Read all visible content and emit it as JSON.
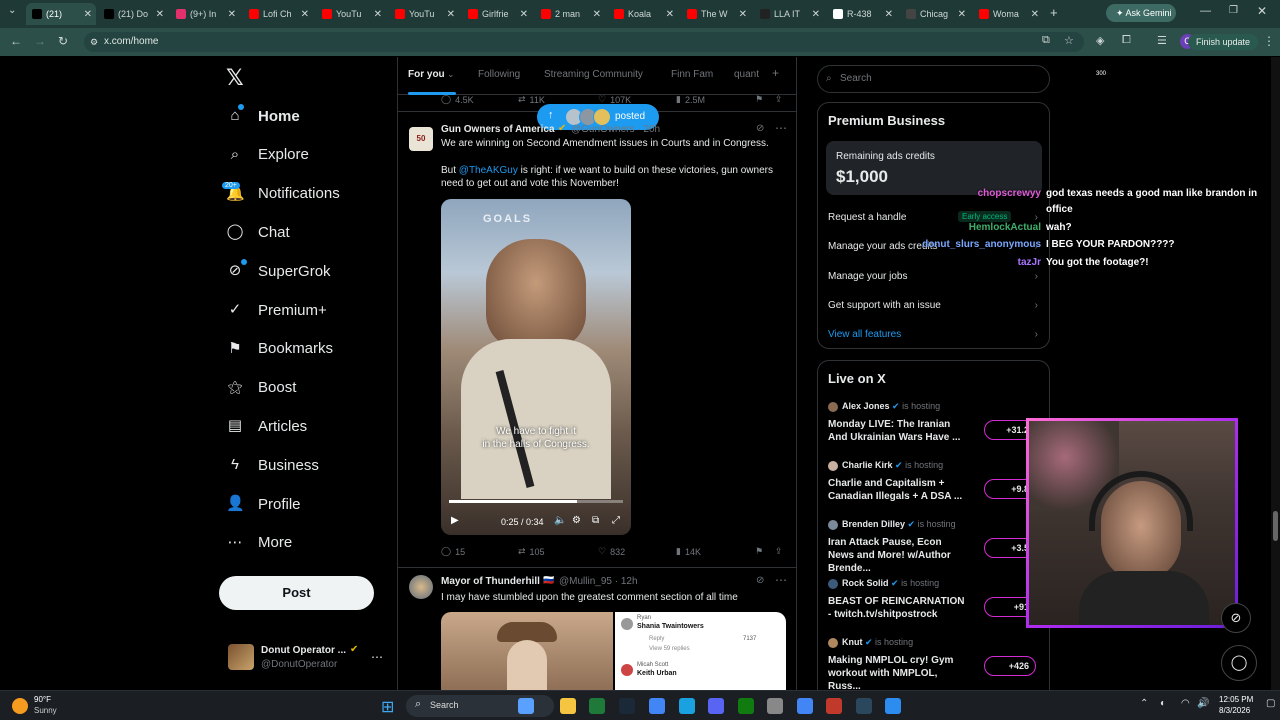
{
  "browser": {
    "tabs": [
      {
        "label": "(21)",
        "color": "#000000"
      },
      {
        "label": "(21) Do",
        "color": "#000000"
      },
      {
        "label": "(9+) In",
        "color": "#e1306c"
      },
      {
        "label": "Lofi Ch",
        "color": "#ff0000"
      },
      {
        "label": "YouTu",
        "color": "#ff0000"
      },
      {
        "label": "YouTu",
        "color": "#ff0000"
      },
      {
        "label": "Girlfrie",
        "color": "#ff0000"
      },
      {
        "label": "2 man",
        "color": "#ff0000"
      },
      {
        "label": "Koala",
        "color": "#ff0000"
      },
      {
        "label": "The W",
        "color": "#ff0000"
      },
      {
        "label": "LLA IT",
        "color": "#222222"
      },
      {
        "label": "R-438",
        "color": "#ffffff"
      },
      {
        "label": "Chicag",
        "color": "#444444"
      },
      {
        "label": "Woma",
        "color": "#ff0000"
      }
    ],
    "ask_gemini": "Ask Gemini",
    "url": "x.com/home",
    "finish_update": "Finish update",
    "ext_badge": "300"
  },
  "nav": {
    "items": [
      {
        "label": "Home",
        "icon": "home-icon",
        "glyph": "⌂"
      },
      {
        "label": "Explore",
        "icon": "search-icon",
        "glyph": "⌕"
      },
      {
        "label": "Notifications",
        "icon": "bell-icon",
        "glyph": "🔔"
      },
      {
        "label": "Chat",
        "icon": "chat-icon",
        "glyph": "◯"
      },
      {
        "label": "SuperGrok",
        "icon": "grok-icon",
        "glyph": "⊘"
      },
      {
        "label": "Premium+",
        "icon": "premium-icon",
        "glyph": "✓"
      },
      {
        "label": "Bookmarks",
        "icon": "bookmark-icon",
        "glyph": "⚑"
      },
      {
        "label": "Boost",
        "icon": "boost-icon",
        "glyph": "⚝"
      },
      {
        "label": "Articles",
        "icon": "articles-icon",
        "glyph": "▤"
      },
      {
        "label": "Business",
        "icon": "lightning-icon",
        "glyph": "ϟ"
      },
      {
        "label": "Profile",
        "icon": "profile-icon",
        "glyph": "👤"
      },
      {
        "label": "More",
        "icon": "more-icon",
        "glyph": "⋯"
      }
    ],
    "notif_badge": "20+",
    "post": "Post",
    "account_name": "Donut Operator ...",
    "account_handle": "@DonutOperator"
  },
  "feed": {
    "tabs": [
      "For you",
      "Following",
      "Streaming Community",
      "Finn Fam",
      "quant"
    ],
    "top_stats": {
      "replies": "4.5K",
      "reposts": "11K",
      "likes": "107K",
      "views": "2.5M"
    },
    "posted_pill": "posted",
    "tweet1": {
      "name": "Gun Owners of America",
      "handle": "@GunOwners · 20h",
      "line1": "We are winning on Second Amendment issues in Courts and in Congress.",
      "line2_pre": "But ",
      "line2_link": "@TheAKGuy",
      "line2_post": " is right: if we want to build on these victories, gun owners need to get out and vote this November!",
      "video_caption_1": "We have to fight it",
      "video_caption_2": "in the halls of Congress.",
      "video_banner": "GOALS",
      "video_time": "0:25 / 0:34",
      "replies": "15",
      "reposts": "105",
      "likes": "832",
      "views": "14K"
    },
    "tweet2": {
      "name": "Mayor of Thunderhill",
      "handle": "@Mullin_95 · 12h",
      "text": "I may have stumbled upon the greatest comment section of all time",
      "img_name_1": "Shania Twaintowers",
      "img_name_2": "Keith Urban",
      "img_ryan": "Ryan",
      "img_reply": "Reply",
      "img_view": "View 59 replies",
      "img_micah": "Micah Scott",
      "img_count": "7137"
    }
  },
  "right": {
    "search_placeholder": "Search",
    "premium_title": "Premium Business",
    "credits_label": "Remaining ads credits",
    "credits_value": "$1,000",
    "rows": [
      "Request a handle",
      "Manage your ads credits",
      "Manage your jobs",
      "Get support with an issue",
      "View all features"
    ],
    "early_access": "Early access",
    "live_title": "Live on X",
    "is_hosting": "is hosting",
    "live": [
      {
        "host": "Alex Jones",
        "title": "Monday LIVE: The Iranian And Ukrainian Wars Have ...",
        "badge": "+31.2"
      },
      {
        "host": "Charlie Kirk",
        "title": "Charlie and Capitalism + Canadian Illegals + A DSA ...",
        "badge": "+9.8"
      },
      {
        "host": "Brenden Dilley",
        "title": "Iran Attack Pause, Econ News and More! w/Author Brende...",
        "badge": "+3.5"
      },
      {
        "host": "Rock Solid",
        "title": "BEAST OF REINCARNATION - twitch.tv/shitpostrock",
        "badge": "+91"
      },
      {
        "host": "Knut",
        "title": "Making NMPLOL cry! Gym workout with NMPLOL, Russ...",
        "badge": "+426"
      }
    ]
  },
  "chat": [
    {
      "user": "chopscrewyy",
      "msg": "god texas needs a good man like brandon in",
      "msg2": "office",
      "color": "#e05ad6"
    },
    {
      "user": "HemlockActual",
      "msg": "wah?",
      "color": "#3fae6a"
    },
    {
      "user": "donut_slurs_anonymous",
      "msg": "I BEG YOUR PARDON????",
      "color": "#7aa7ff"
    },
    {
      "user": "tazJr",
      "msg": "You got the footage?!",
      "color": "#a875ff"
    }
  ],
  "taskbar": {
    "weather_temp": "90°F",
    "weather_desc": "Sunny",
    "search": "Search",
    "time": "12:05 PM",
    "date": "8/3/2026"
  }
}
